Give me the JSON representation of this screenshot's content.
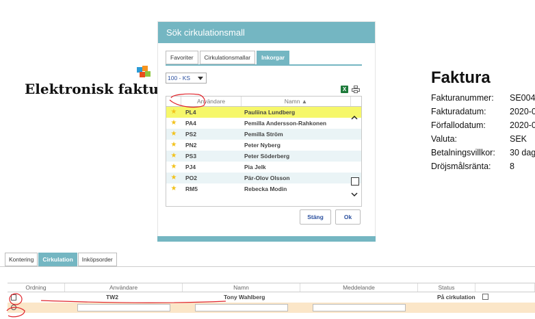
{
  "invoice": {
    "logo_text": "Elektronisk faktu",
    "title": "Faktura",
    "fields": [
      {
        "label": "Fakturanummer:",
        "value": "SE004"
      },
      {
        "label": "Fakturadatum:",
        "value": "2020-0"
      },
      {
        "label": "Förfallodatum:",
        "value": "2020-0"
      },
      {
        "label": "Valuta:",
        "value": "SEK"
      },
      {
        "label": "Betalningsvillkor:",
        "value": "30 dag"
      },
      {
        "label": "Dröjsmålsränta:",
        "value": "8"
      }
    ]
  },
  "dialog": {
    "title": "Sök cirkulationsmall",
    "tabs": [
      {
        "label": "Favoriter",
        "active": false
      },
      {
        "label": "Cirkulationsmallar",
        "active": false
      },
      {
        "label": "Inkorgar",
        "active": true
      }
    ],
    "select_value": "100 - KS",
    "columns": {
      "user": "Användare",
      "name": "Namn ▲"
    },
    "rows": [
      {
        "user": "PL4",
        "name": "Pauliina Lundberg",
        "selected": true
      },
      {
        "user": "PA4",
        "name": "Pemilla Andersson-Rahkonen",
        "selected": false
      },
      {
        "user": "PS2",
        "name": "Pemilla Ström",
        "selected": false
      },
      {
        "user": "PN2",
        "name": "Peter Nyberg",
        "selected": false
      },
      {
        "user": "PS3",
        "name": "Peter Söderberg",
        "selected": false
      },
      {
        "user": "PJ4",
        "name": "Pia Jelk",
        "selected": false
      },
      {
        "user": "PO2",
        "name": "Pär-Olov Olsson",
        "selected": false
      },
      {
        "user": "RM5",
        "name": "Rebecka Modin",
        "selected": false
      }
    ],
    "buttons": {
      "close": "Stäng",
      "ok": "Ok"
    },
    "icons": {
      "excel": "excel-icon",
      "print": "print-icon",
      "star": "star-icon"
    },
    "excel_glyph": "X"
  },
  "bottom": {
    "tabs": [
      {
        "label": "Kontering",
        "active": false
      },
      {
        "label": "Cirkulation",
        "active": true
      },
      {
        "label": "Inköpsorder",
        "active": false
      }
    ],
    "columns": [
      "Ordning",
      "Användare",
      "Namn",
      "Meddelande",
      "Status",
      ""
    ],
    "row": {
      "user": "TW2",
      "name": "Tony Wahlberg",
      "message": "",
      "status": "På cirkulation"
    }
  },
  "colors": {
    "accent": "#74b6c2",
    "highlight": "#f6f76a",
    "annotation": "#e0232a",
    "edit_row": "#fbe6c8"
  }
}
